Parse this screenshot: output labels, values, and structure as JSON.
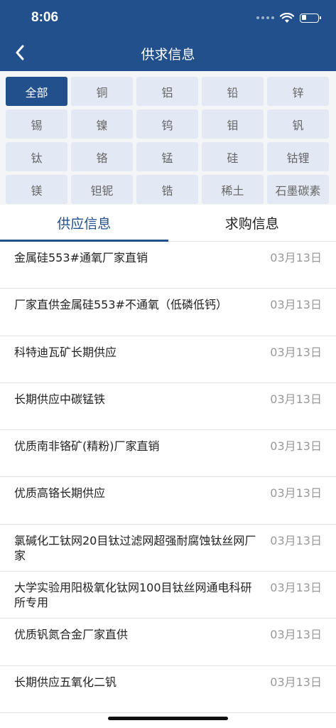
{
  "status_bar": {
    "time": "8:06"
  },
  "nav": {
    "title": "供求信息",
    "back_icon": "chevron-left-icon"
  },
  "categories": [
    {
      "label": "全部",
      "active": true
    },
    {
      "label": "铜"
    },
    {
      "label": "铝"
    },
    {
      "label": "铅"
    },
    {
      "label": "锌"
    },
    {
      "label": "锡"
    },
    {
      "label": "镍"
    },
    {
      "label": "钨"
    },
    {
      "label": "钼"
    },
    {
      "label": "钒"
    },
    {
      "label": "钛"
    },
    {
      "label": "铬"
    },
    {
      "label": "锰"
    },
    {
      "label": "硅"
    },
    {
      "label": "钴锂"
    },
    {
      "label": "镁"
    },
    {
      "label": "钽铌"
    },
    {
      "label": "锆"
    },
    {
      "label": "稀土"
    },
    {
      "label": "石墨碳素"
    }
  ],
  "tabs": [
    {
      "label": "供应信息",
      "active": true
    },
    {
      "label": "求购信息"
    }
  ],
  "items": [
    {
      "title": "金属硅553#通氧厂家直销",
      "date": "03月13日"
    },
    {
      "title": "厂家直供金属硅553#不通氧（低磷低钙）",
      "date": "03月13日"
    },
    {
      "title": "科特迪瓦矿长期供应",
      "date": "03月13日"
    },
    {
      "title": "长期供应中碳锰铁",
      "date": "03月13日"
    },
    {
      "title": "优质南非铬矿(精粉)厂家直销",
      "date": "03月13日"
    },
    {
      "title": "优质高铬长期供应",
      "date": "03月13日"
    },
    {
      "title": "氯碱化工钛网20目钛过滤网超强耐腐蚀钛丝网厂家",
      "date": "03月13日"
    },
    {
      "title": "大学实验用阳极氧化钛网100目钛丝网通电科研所专用",
      "date": "03月13日"
    },
    {
      "title": "优质钒氮合金厂家直供",
      "date": "03月13日"
    },
    {
      "title": "长期供应五氧化二钒",
      "date": "03月13日"
    }
  ],
  "colors": {
    "primary": "#22508c",
    "chip_bg": "#e3e9f4",
    "date": "#999999"
  }
}
